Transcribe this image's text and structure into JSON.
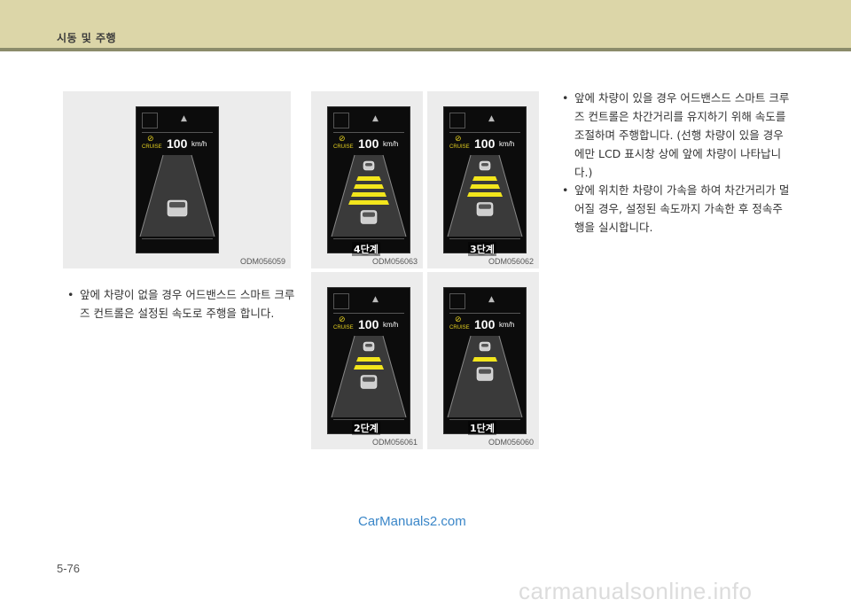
{
  "header": {
    "section_title": "시동 및 주행"
  },
  "figures": [
    {
      "id": "fig-main",
      "code": "ODM056059",
      "level": "",
      "speed": "100",
      "unit": "km/h",
      "cruise": "CRUISE",
      "bars": 0
    },
    {
      "id": "fig-4",
      "code": "ODM056063",
      "level": "4단계",
      "speed": "100",
      "unit": "km/h",
      "cruise": "CRUISE",
      "bars": 4
    },
    {
      "id": "fig-3",
      "code": "ODM056062",
      "level": "3단계",
      "speed": "100",
      "unit": "km/h",
      "cruise": "CRUISE",
      "bars": 3
    },
    {
      "id": "fig-2",
      "code": "ODM056061",
      "level": "2단계",
      "speed": "100",
      "unit": "km/h",
      "cruise": "CRUISE",
      "bars": 2
    },
    {
      "id": "fig-1",
      "code": "ODM056060",
      "level": "1단계",
      "speed": "100",
      "unit": "km/h",
      "cruise": "CRUISE",
      "bars": 1
    }
  ],
  "left_bullets": [
    "앞에 차량이 없을 경우 어드밴스드 스마트 크루즈 컨트롤은 설정된 속도로 주행을 합니다."
  ],
  "right_bullets": [
    "앞에 차량이 있을 경우 어드밴스드 스마트 크루즈 컨트롤은 차간거리를 유지하기 위해 속도를 조절하며 주행합니다. (선행 차량이 있을 경우에만 LCD 표시창 상에 앞에 차량이 나타납니다.)",
    "앞에 위치한 차량이 가속을 하여 차간거리가 멀어질 경우, 설정된 속도까지 가속한 후 정속주행을 실시합니다."
  ],
  "footer": {
    "page_number": "5-76",
    "watermark": "CarManuals2.com",
    "site": "carmanualsonline.info"
  },
  "colors": {
    "header_band": "#dcd6a8",
    "header_line": "#8c8c6b",
    "accent_yellow": "#e8d320"
  }
}
